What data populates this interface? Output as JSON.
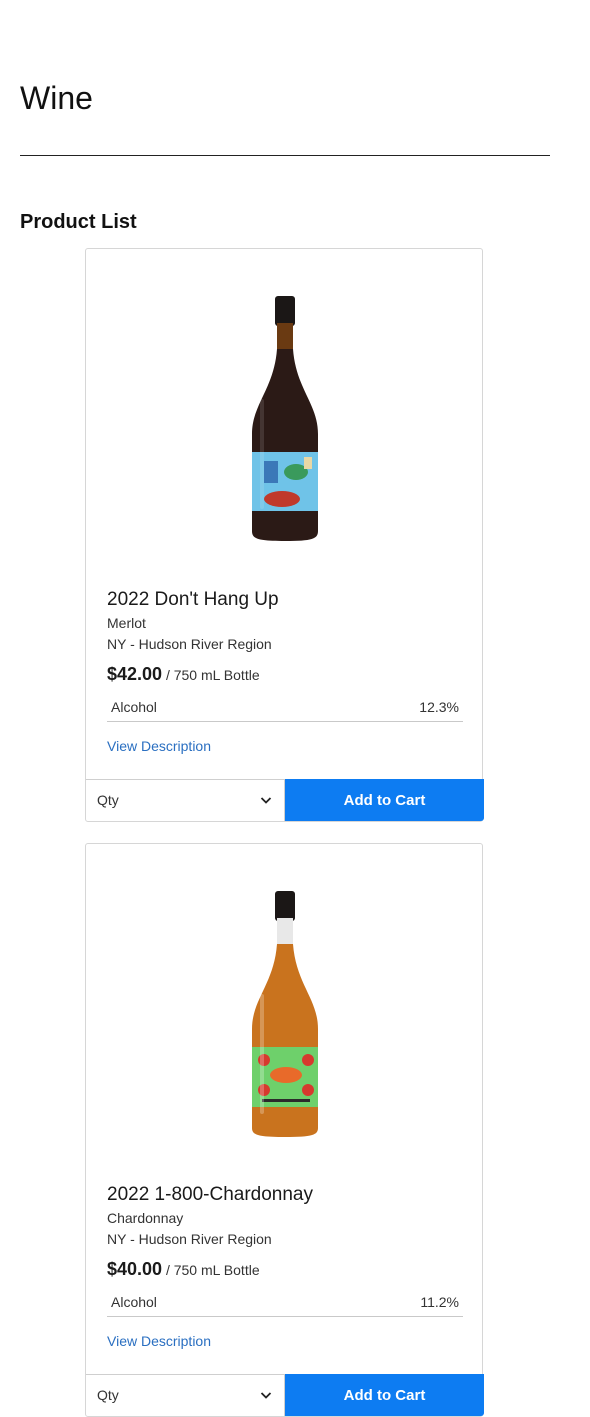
{
  "page": {
    "title": "Wine",
    "section_title": "Product List"
  },
  "products": [
    {
      "name": "2022 Don't Hang Up",
      "varietal": "Merlot",
      "region": "NY - Hudson River Region",
      "price": "$42.00",
      "unit": "/ 750 mL Bottle",
      "spec_label": "Alcohol",
      "spec_value": "12.3%",
      "description_link": "View Description",
      "qty_placeholder": "Qty",
      "button_label": "Add to Cart",
      "bottle_color": "#2b1a16",
      "label_color": "#6fc3e8"
    },
    {
      "name": "2022 1-800-Chardonnay",
      "varietal": "Chardonnay",
      "region": "NY - Hudson River Region",
      "price": "$40.00",
      "unit": "/ 750 mL Bottle",
      "spec_label": "Alcohol",
      "spec_value": "11.2%",
      "description_link": "View Description",
      "qty_placeholder": "Qty",
      "button_label": "Add to Cart",
      "bottle_color": "#c9731e",
      "label_color": "#6ed06b"
    }
  ],
  "icons": {
    "qty_chevron": "chevron-down-icon"
  },
  "colors": {
    "accent": "#0d7cf2",
    "link": "#2a6fc1"
  }
}
